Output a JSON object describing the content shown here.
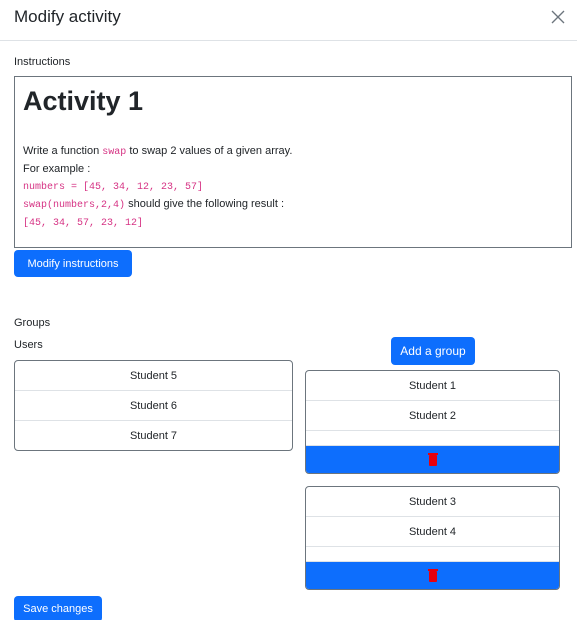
{
  "modal": {
    "title": "Modify activity",
    "close_icon": "close-icon"
  },
  "instructions": {
    "label": "Instructions",
    "heading": "Activity 1",
    "line1_prefix": "Write a function ",
    "line1_code": "swap",
    "line1_suffix": " to swap 2 values of a given array.",
    "line2": "For example :",
    "line3_code": "numbers = [45, 34, 12, 23, 57]",
    "line4_code": "swap(numbers,2,4)",
    "line4_suffix": " should give the following result :",
    "line5_code": "[45, 34, 57, 23, 12]",
    "modify_button": "Modify instructions"
  },
  "groups_label": "Groups",
  "users": {
    "label": "Users",
    "items": [
      "Student 5",
      "Student 6",
      "Student 7"
    ]
  },
  "add_group_button": "Add a group",
  "groups": [
    {
      "members": [
        "Student 1",
        "Student 2"
      ],
      "delete_icon": "trash-icon"
    },
    {
      "members": [
        "Student 3",
        "Student 4"
      ],
      "delete_icon": "trash-icon"
    }
  ],
  "save_button": "Save changes",
  "colors": {
    "primary": "#0d6efd",
    "danger": "#e8000d",
    "code": "#d63384"
  }
}
